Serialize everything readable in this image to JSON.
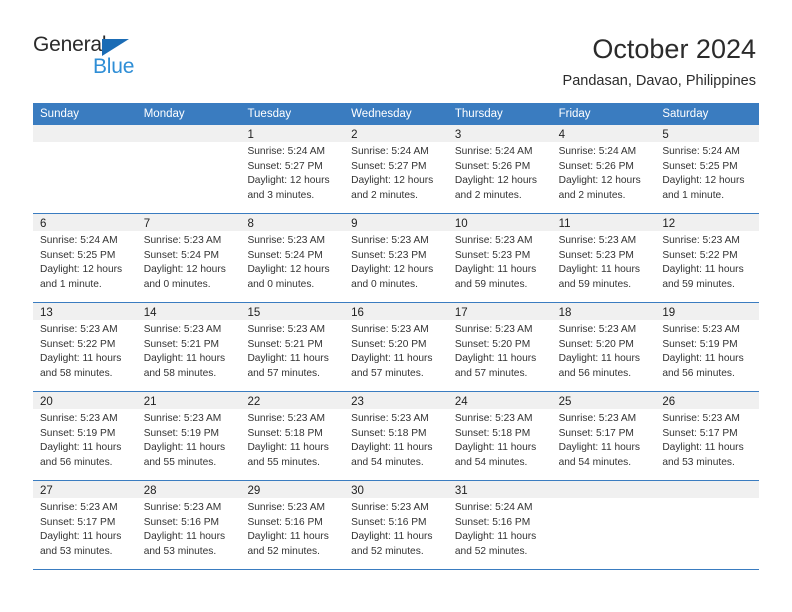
{
  "logo": {
    "text_top": "General",
    "text_bottom": "Blue",
    "triangle_color": "#1b6cb5",
    "bottom_color": "#2f8ed6"
  },
  "header": {
    "title": "October 2024",
    "subtitle": "Pandasan, Davao, Philippines"
  },
  "theme": {
    "header_blue": "#3a7cc0",
    "cell_head_gray": "#f0f0f0"
  },
  "weekdays": [
    "Sunday",
    "Monday",
    "Tuesday",
    "Wednesday",
    "Thursday",
    "Friday",
    "Saturday"
  ],
  "weeks": [
    [
      {
        "day": "",
        "empty": true
      },
      {
        "day": "",
        "empty": true
      },
      {
        "day": "1",
        "sunrise": "Sunrise: 5:24 AM",
        "sunset": "Sunset: 5:27 PM",
        "daylight1": "Daylight: 12 hours",
        "daylight2": "and 3 minutes."
      },
      {
        "day": "2",
        "sunrise": "Sunrise: 5:24 AM",
        "sunset": "Sunset: 5:27 PM",
        "daylight1": "Daylight: 12 hours",
        "daylight2": "and 2 minutes."
      },
      {
        "day": "3",
        "sunrise": "Sunrise: 5:24 AM",
        "sunset": "Sunset: 5:26 PM",
        "daylight1": "Daylight: 12 hours",
        "daylight2": "and 2 minutes."
      },
      {
        "day": "4",
        "sunrise": "Sunrise: 5:24 AM",
        "sunset": "Sunset: 5:26 PM",
        "daylight1": "Daylight: 12 hours",
        "daylight2": "and 2 minutes."
      },
      {
        "day": "5",
        "sunrise": "Sunrise: 5:24 AM",
        "sunset": "Sunset: 5:25 PM",
        "daylight1": "Daylight: 12 hours",
        "daylight2": "and 1 minute."
      }
    ],
    [
      {
        "day": "6",
        "sunrise": "Sunrise: 5:24 AM",
        "sunset": "Sunset: 5:25 PM",
        "daylight1": "Daylight: 12 hours",
        "daylight2": "and 1 minute."
      },
      {
        "day": "7",
        "sunrise": "Sunrise: 5:23 AM",
        "sunset": "Sunset: 5:24 PM",
        "daylight1": "Daylight: 12 hours",
        "daylight2": "and 0 minutes."
      },
      {
        "day": "8",
        "sunrise": "Sunrise: 5:23 AM",
        "sunset": "Sunset: 5:24 PM",
        "daylight1": "Daylight: 12 hours",
        "daylight2": "and 0 minutes."
      },
      {
        "day": "9",
        "sunrise": "Sunrise: 5:23 AM",
        "sunset": "Sunset: 5:23 PM",
        "daylight1": "Daylight: 12 hours",
        "daylight2": "and 0 minutes."
      },
      {
        "day": "10",
        "sunrise": "Sunrise: 5:23 AM",
        "sunset": "Sunset: 5:23 PM",
        "daylight1": "Daylight: 11 hours",
        "daylight2": "and 59 minutes."
      },
      {
        "day": "11",
        "sunrise": "Sunrise: 5:23 AM",
        "sunset": "Sunset: 5:23 PM",
        "daylight1": "Daylight: 11 hours",
        "daylight2": "and 59 minutes."
      },
      {
        "day": "12",
        "sunrise": "Sunrise: 5:23 AM",
        "sunset": "Sunset: 5:22 PM",
        "daylight1": "Daylight: 11 hours",
        "daylight2": "and 59 minutes."
      }
    ],
    [
      {
        "day": "13",
        "sunrise": "Sunrise: 5:23 AM",
        "sunset": "Sunset: 5:22 PM",
        "daylight1": "Daylight: 11 hours",
        "daylight2": "and 58 minutes."
      },
      {
        "day": "14",
        "sunrise": "Sunrise: 5:23 AM",
        "sunset": "Sunset: 5:21 PM",
        "daylight1": "Daylight: 11 hours",
        "daylight2": "and 58 minutes."
      },
      {
        "day": "15",
        "sunrise": "Sunrise: 5:23 AM",
        "sunset": "Sunset: 5:21 PM",
        "daylight1": "Daylight: 11 hours",
        "daylight2": "and 57 minutes."
      },
      {
        "day": "16",
        "sunrise": "Sunrise: 5:23 AM",
        "sunset": "Sunset: 5:20 PM",
        "daylight1": "Daylight: 11 hours",
        "daylight2": "and 57 minutes."
      },
      {
        "day": "17",
        "sunrise": "Sunrise: 5:23 AM",
        "sunset": "Sunset: 5:20 PM",
        "daylight1": "Daylight: 11 hours",
        "daylight2": "and 57 minutes."
      },
      {
        "day": "18",
        "sunrise": "Sunrise: 5:23 AM",
        "sunset": "Sunset: 5:20 PM",
        "daylight1": "Daylight: 11 hours",
        "daylight2": "and 56 minutes."
      },
      {
        "day": "19",
        "sunrise": "Sunrise: 5:23 AM",
        "sunset": "Sunset: 5:19 PM",
        "daylight1": "Daylight: 11 hours",
        "daylight2": "and 56 minutes."
      }
    ],
    [
      {
        "day": "20",
        "sunrise": "Sunrise: 5:23 AM",
        "sunset": "Sunset: 5:19 PM",
        "daylight1": "Daylight: 11 hours",
        "daylight2": "and 56 minutes."
      },
      {
        "day": "21",
        "sunrise": "Sunrise: 5:23 AM",
        "sunset": "Sunset: 5:19 PM",
        "daylight1": "Daylight: 11 hours",
        "daylight2": "and 55 minutes."
      },
      {
        "day": "22",
        "sunrise": "Sunrise: 5:23 AM",
        "sunset": "Sunset: 5:18 PM",
        "daylight1": "Daylight: 11 hours",
        "daylight2": "and 55 minutes."
      },
      {
        "day": "23",
        "sunrise": "Sunrise: 5:23 AM",
        "sunset": "Sunset: 5:18 PM",
        "daylight1": "Daylight: 11 hours",
        "daylight2": "and 54 minutes."
      },
      {
        "day": "24",
        "sunrise": "Sunrise: 5:23 AM",
        "sunset": "Sunset: 5:18 PM",
        "daylight1": "Daylight: 11 hours",
        "daylight2": "and 54 minutes."
      },
      {
        "day": "25",
        "sunrise": "Sunrise: 5:23 AM",
        "sunset": "Sunset: 5:17 PM",
        "daylight1": "Daylight: 11 hours",
        "daylight2": "and 54 minutes."
      },
      {
        "day": "26",
        "sunrise": "Sunrise: 5:23 AM",
        "sunset": "Sunset: 5:17 PM",
        "daylight1": "Daylight: 11 hours",
        "daylight2": "and 53 minutes."
      }
    ],
    [
      {
        "day": "27",
        "sunrise": "Sunrise: 5:23 AM",
        "sunset": "Sunset: 5:17 PM",
        "daylight1": "Daylight: 11 hours",
        "daylight2": "and 53 minutes."
      },
      {
        "day": "28",
        "sunrise": "Sunrise: 5:23 AM",
        "sunset": "Sunset: 5:16 PM",
        "daylight1": "Daylight: 11 hours",
        "daylight2": "and 53 minutes."
      },
      {
        "day": "29",
        "sunrise": "Sunrise: 5:23 AM",
        "sunset": "Sunset: 5:16 PM",
        "daylight1": "Daylight: 11 hours",
        "daylight2": "and 52 minutes."
      },
      {
        "day": "30",
        "sunrise": "Sunrise: 5:23 AM",
        "sunset": "Sunset: 5:16 PM",
        "daylight1": "Daylight: 11 hours",
        "daylight2": "and 52 minutes."
      },
      {
        "day": "31",
        "sunrise": "Sunrise: 5:24 AM",
        "sunset": "Sunset: 5:16 PM",
        "daylight1": "Daylight: 11 hours",
        "daylight2": "and 52 minutes."
      },
      {
        "day": "",
        "empty": true
      },
      {
        "day": "",
        "empty": true
      }
    ]
  ]
}
